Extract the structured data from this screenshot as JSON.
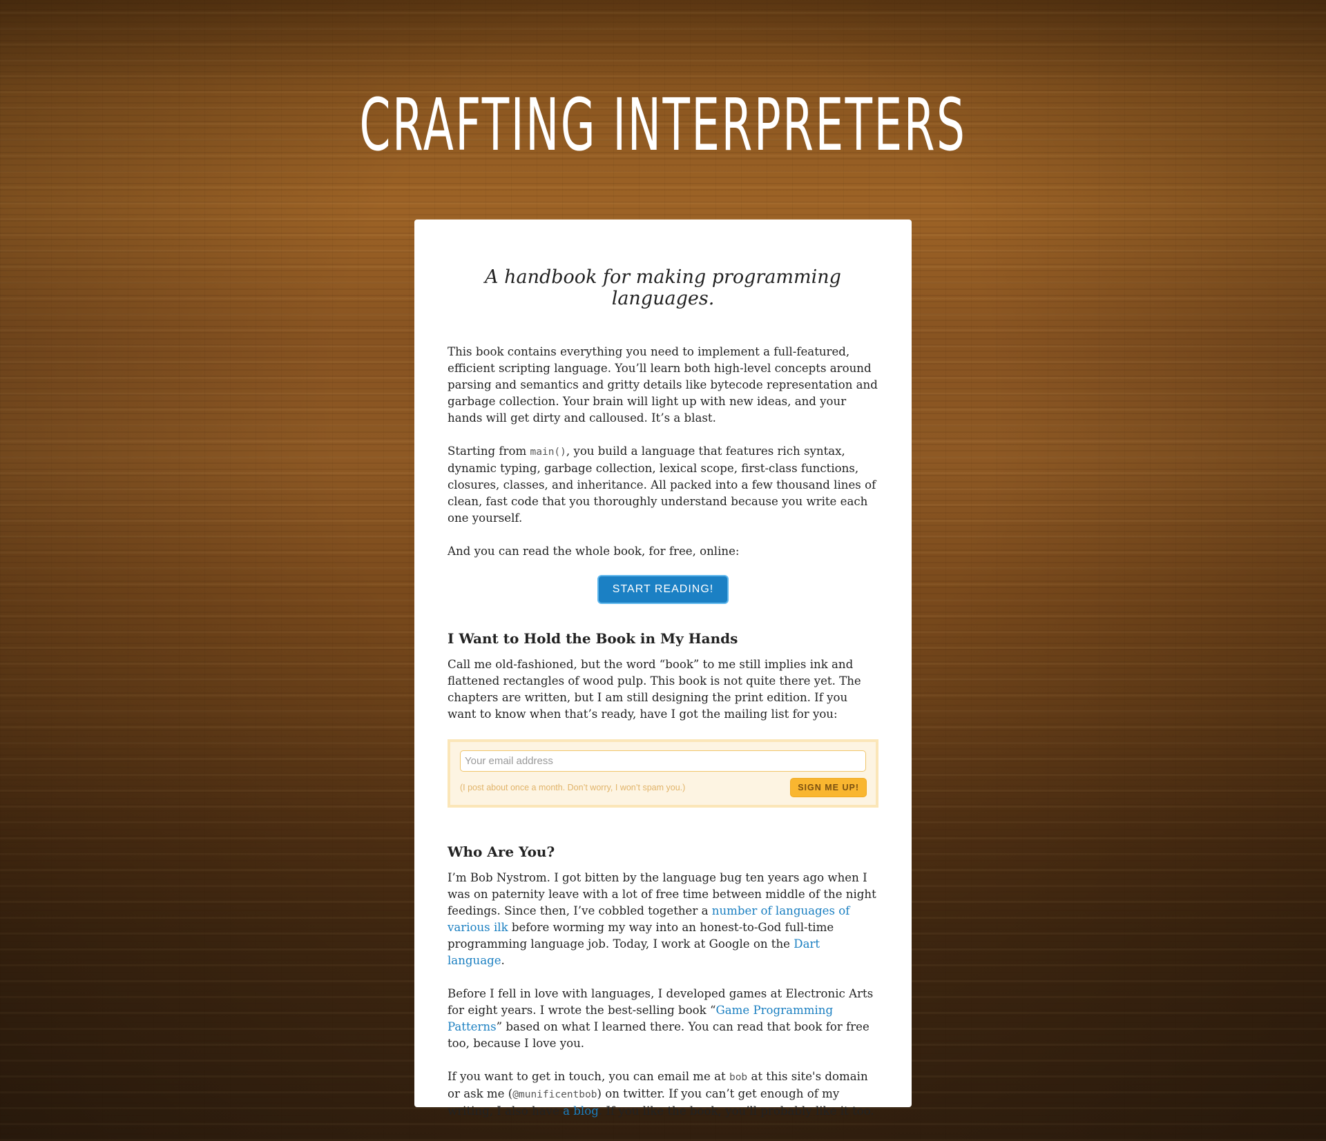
{
  "site_title": "CRAFTING INTERPRETERS",
  "tagline": "A handbook for making programming languages.",
  "intro": {
    "p1": "This book contains everything you need to implement a full-featured, efficient scripting language. You’ll learn both high-level concepts around parsing and semantics and gritty details like bytecode representation and garbage collection. Your brain will light up with new ideas, and your hands will get dirty and calloused. It’s a blast.",
    "p2_before": "Starting from ",
    "p2_code": "main()",
    "p2_after": ", you build a language that features rich syntax, dynamic typing, garbage collection, lexical scope, first-class functions, closures, classes, and inheritance. All packed into a few thousand lines of clean, fast code that you thoroughly understand because you write each one yourself.",
    "p3": "And you can read the whole book, for free, online:",
    "start_button": "START READING!"
  },
  "hold_book": {
    "heading": "I Want to Hold the Book in My Hands",
    "p1": "Call me old-fashioned, but the word “book” to me still implies ink and flattened rectangles of wood pulp. This book is not quite there yet. The chapters are written, but I am still designing the print edition. If you want to know when that’s ready, have I got the mailing list for you:"
  },
  "signup": {
    "email_placeholder": "Your email address",
    "note": "(I post about once a month. Don’t worry, I won’t spam you.)",
    "button": "SIGN ME UP!"
  },
  "who": {
    "heading": "Who Are You?",
    "p1_a": "I’m Bob Nystrom. I got bitten by the language bug ten years ago when I was on paternity leave with a lot of free time between middle of the night feedings. Since then, I’ve cobbled together a ",
    "p1_link1": "number of languages of various ilk",
    "p1_b": " before worming my way into an honest-to-God full-time programming language job. Today, I work at Google on the ",
    "p1_link2": "Dart language",
    "p1_c": ".",
    "p2_a": "Before I fell in love with languages, I developed games at Electronic Arts for eight years. I wrote the best-selling book “",
    "p2_link": "Game Programming Patterns",
    "p2_b": "” based on what I learned there. You can read that book for free too, because I love you.",
    "p3_a": "If you want to get in touch, you can email me at ",
    "p3_code1": "bob",
    "p3_b": " at this site's domain or ask me (",
    "p3_code2": "@munificentbob",
    "p3_c": ") on twitter. If you can’t get enough of my writing, I also have ",
    "p3_link": "a blog",
    "p3_d": ". If you like the book, you’ll probably like it too."
  }
}
